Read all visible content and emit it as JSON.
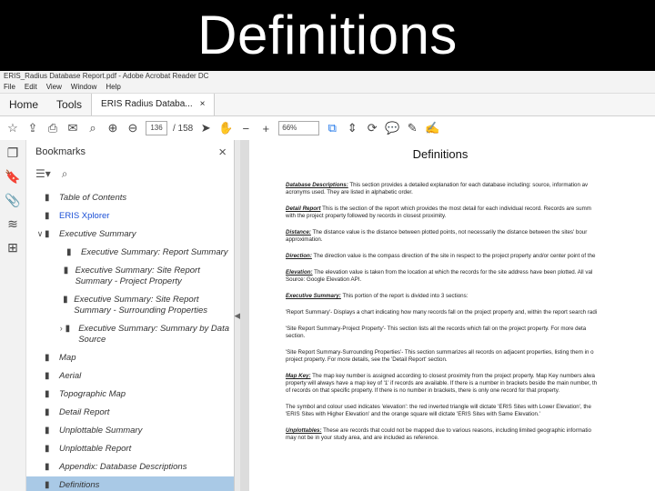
{
  "slide": {
    "title": "Definitions"
  },
  "window": {
    "title": "ERIS_Radius Database Report.pdf - Adobe Acrobat Reader DC",
    "menu": [
      "File",
      "Edit",
      "View",
      "Window",
      "Help"
    ]
  },
  "tabs": {
    "home": "Home",
    "tools": "Tools",
    "doc": "ERIS Radius Databa..."
  },
  "toolbar": {
    "page_current": "136",
    "page_total": "/ 158",
    "zoom": "66%"
  },
  "panel": {
    "title": "Bookmarks",
    "close": "×"
  },
  "bookmarks": [
    {
      "label": "Table of Contents",
      "indent": 0,
      "italic": true
    },
    {
      "label": "ERIS Xplorer",
      "indent": 0,
      "italic": false,
      "color": "#1a4fd6"
    },
    {
      "label": "Executive Summary",
      "indent": 0,
      "italic": true,
      "expanded": true
    },
    {
      "label": "Executive Summary: Report Summary",
      "indent": 1,
      "italic": true
    },
    {
      "label": "Executive Summary: Site Report Summary - Project Property",
      "indent": 1,
      "italic": true
    },
    {
      "label": "Executive Summary: Site Report Summary - Surrounding Properties",
      "indent": 1,
      "italic": true
    },
    {
      "label": "Executive Summary: Summary by Data Source",
      "indent": 1,
      "italic": true,
      "collapsed": true
    },
    {
      "label": "Map",
      "indent": 0,
      "italic": true
    },
    {
      "label": "Aerial",
      "indent": 0,
      "italic": true
    },
    {
      "label": "Topographic Map",
      "indent": 0,
      "italic": true
    },
    {
      "label": "Detail Report",
      "indent": 0,
      "italic": true
    },
    {
      "label": "Unplottable Summary",
      "indent": 0,
      "italic": true
    },
    {
      "label": "Unplottable Report",
      "indent": 0,
      "italic": true
    },
    {
      "label": "Appendix: Database Descriptions",
      "indent": 0,
      "italic": true
    },
    {
      "label": "Definitions",
      "indent": 0,
      "italic": true,
      "selected": true
    }
  ],
  "page": {
    "title": "Definitions",
    "paragraphs": [
      {
        "label": "Database Descriptions:",
        "lines": [
          " This section provides a detailed explanation for each database including: source, information av",
          "acronyms used. They are listed in alphabetic order."
        ]
      },
      {
        "label": "Detail Report",
        "lines": [
          " This is the section of the report which provides the most detail for each individual record. Records are summ",
          "with the project property followed by records in closest proximity."
        ]
      },
      {
        "label": "Distance:",
        "lines": [
          " The distance value is the distance between plotted points, not necessarily the distance between the sites' bour",
          "approximation."
        ]
      },
      {
        "label": "Direction:",
        "lines": [
          " The direction value is the compass direction of the site in respect to the project property and/or center point of the"
        ]
      },
      {
        "label": "Elevation:",
        "lines": [
          " The elevation value is taken from the location at which the records for the site address have been plotted. All val",
          "Source: Google Elevation API."
        ]
      },
      {
        "label": "Executive Summary:",
        "lines": [
          " This portion of the report is divided into 3 sections:"
        ]
      },
      {
        "label": "",
        "lines": [
          "'Report Summary'- Displays a chart indicating how many records fall on the project property and, within the report search radi"
        ]
      },
      {
        "label": "",
        "lines": [
          "'Site Report Summary-Project Property'- This section lists all the records which fall on the project property. For more deta",
          "section."
        ]
      },
      {
        "label": "",
        "lines": [
          "'Site Report Summary-Surrounding Properties'- This section summarizes all records on adjacent properties, listing them in o",
          "project property. For more details, see the 'Detail Report' section."
        ]
      },
      {
        "label": "Map Key:",
        "lines": [
          " The map key number is assigned according to closest proximity from the project property. Map Key numbers alwa",
          "property will always have a map key of '1' if records are available. If there is a number in brackets beside the main number, th",
          "of records on that specific property. If there is no number in brackets, there is only one record for that property."
        ]
      },
      {
        "label": "",
        "lines": [
          "The symbol and colour used indicates 'elevation': the red inverted triangle will dictate 'ERIS Sites with Lower Elevation', the",
          "'ERIS Sites with Higher Elevation' and the orange square will dictate 'ERIS Sites with Same Elevation.'"
        ]
      },
      {
        "label": "Unplottables:",
        "lines": [
          " These are records that could not be mapped due to various reasons, including limited geographic informatio",
          "may not be in your study area, and are included as reference."
        ]
      }
    ]
  }
}
